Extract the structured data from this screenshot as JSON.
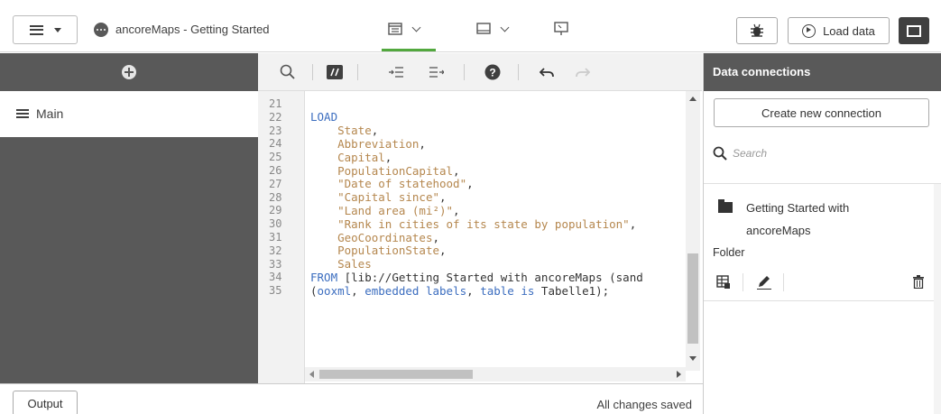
{
  "header": {
    "app_title": "ancoreMaps - Getting Started",
    "load_label": "Load data",
    "icons": {
      "nav": "hamburger-menu-icon",
      "app": "app-icon",
      "prepare": "data-manager-icon",
      "analyze": "sheet-icon",
      "story": "story-icon",
      "debug": "bug-icon",
      "load": "play-icon",
      "panel": "panel-toggle-icon"
    }
  },
  "colors": {
    "dark_panel": "#595959",
    "keyword": "#3b6dbf",
    "field": "#b5874e",
    "active_mode": "#52a83e"
  },
  "sections": {
    "add_icon": "plus-circle-icon",
    "items": [
      {
        "label": "Main"
      }
    ]
  },
  "toolbar": {
    "icons": [
      "search-icon",
      "comment-icon",
      "indent-icon",
      "outdent-icon",
      "help-icon",
      "undo-icon",
      "redo-icon"
    ]
  },
  "editor": {
    "lines": [
      {
        "num": "21",
        "segments": []
      },
      {
        "num": "22",
        "segments": [
          {
            "t": "LOAD",
            "c": "kw"
          }
        ]
      },
      {
        "num": "23",
        "segments": [
          {
            "t": "    "
          },
          {
            "t": "State",
            "c": "fld"
          },
          {
            "t": ","
          }
        ]
      },
      {
        "num": "24",
        "segments": [
          {
            "t": "    "
          },
          {
            "t": "Abbreviation",
            "c": "fld"
          },
          {
            "t": ","
          }
        ]
      },
      {
        "num": "25",
        "segments": [
          {
            "t": "    "
          },
          {
            "t": "Capital",
            "c": "fld"
          },
          {
            "t": ","
          }
        ]
      },
      {
        "num": "26",
        "segments": [
          {
            "t": "    "
          },
          {
            "t": "PopulationCapital",
            "c": "fld"
          },
          {
            "t": ","
          }
        ]
      },
      {
        "num": "27",
        "segments": [
          {
            "t": "    "
          },
          {
            "t": "\"Date of statehood\"",
            "c": "fld"
          },
          {
            "t": ","
          }
        ]
      },
      {
        "num": "28",
        "segments": [
          {
            "t": "    "
          },
          {
            "t": "\"Capital since\"",
            "c": "fld"
          },
          {
            "t": ","
          }
        ]
      },
      {
        "num": "29",
        "segments": [
          {
            "t": "    "
          },
          {
            "t": "\"Land area (mi²)\"",
            "c": "fld"
          },
          {
            "t": ","
          }
        ]
      },
      {
        "num": "30",
        "segments": [
          {
            "t": "    "
          },
          {
            "t": "\"Rank in cities of its state by population\"",
            "c": "fld"
          },
          {
            "t": ","
          }
        ]
      },
      {
        "num": "31",
        "segments": [
          {
            "t": "    "
          },
          {
            "t": "GeoCoordinates",
            "c": "fld"
          },
          {
            "t": ","
          }
        ]
      },
      {
        "num": "32",
        "segments": [
          {
            "t": "    "
          },
          {
            "t": "PopulationState",
            "c": "fld"
          },
          {
            "t": ","
          }
        ]
      },
      {
        "num": "33",
        "segments": [
          {
            "t": "    "
          },
          {
            "t": "Sales",
            "c": "fld"
          }
        ]
      },
      {
        "num": "34",
        "segments": [
          {
            "t": "FROM",
            "c": "kw"
          },
          {
            "t": " [lib://Getting Started with ancoreMaps (sand"
          }
        ]
      },
      {
        "num": "35",
        "segments": [
          {
            "t": "("
          },
          {
            "t": "ooxml",
            "c": "kw"
          },
          {
            "t": ", "
          },
          {
            "t": "embedded labels",
            "c": "kw"
          },
          {
            "t": ", "
          },
          {
            "t": "table is",
            "c": "kw"
          },
          {
            "t": " Tabelle1);"
          }
        ]
      }
    ]
  },
  "footer": {
    "output_label": "Output",
    "status": "All changes saved"
  },
  "data_connections": {
    "title": "Data connections",
    "create_label": "Create new connection",
    "search_placeholder": "Search",
    "items": [
      {
        "name": "Getting Started with ancoreMaps",
        "type": "Folder",
        "icon": "folder-icon",
        "actions": [
          "select-data-icon",
          "edit-icon",
          "delete-icon"
        ]
      }
    ]
  }
}
